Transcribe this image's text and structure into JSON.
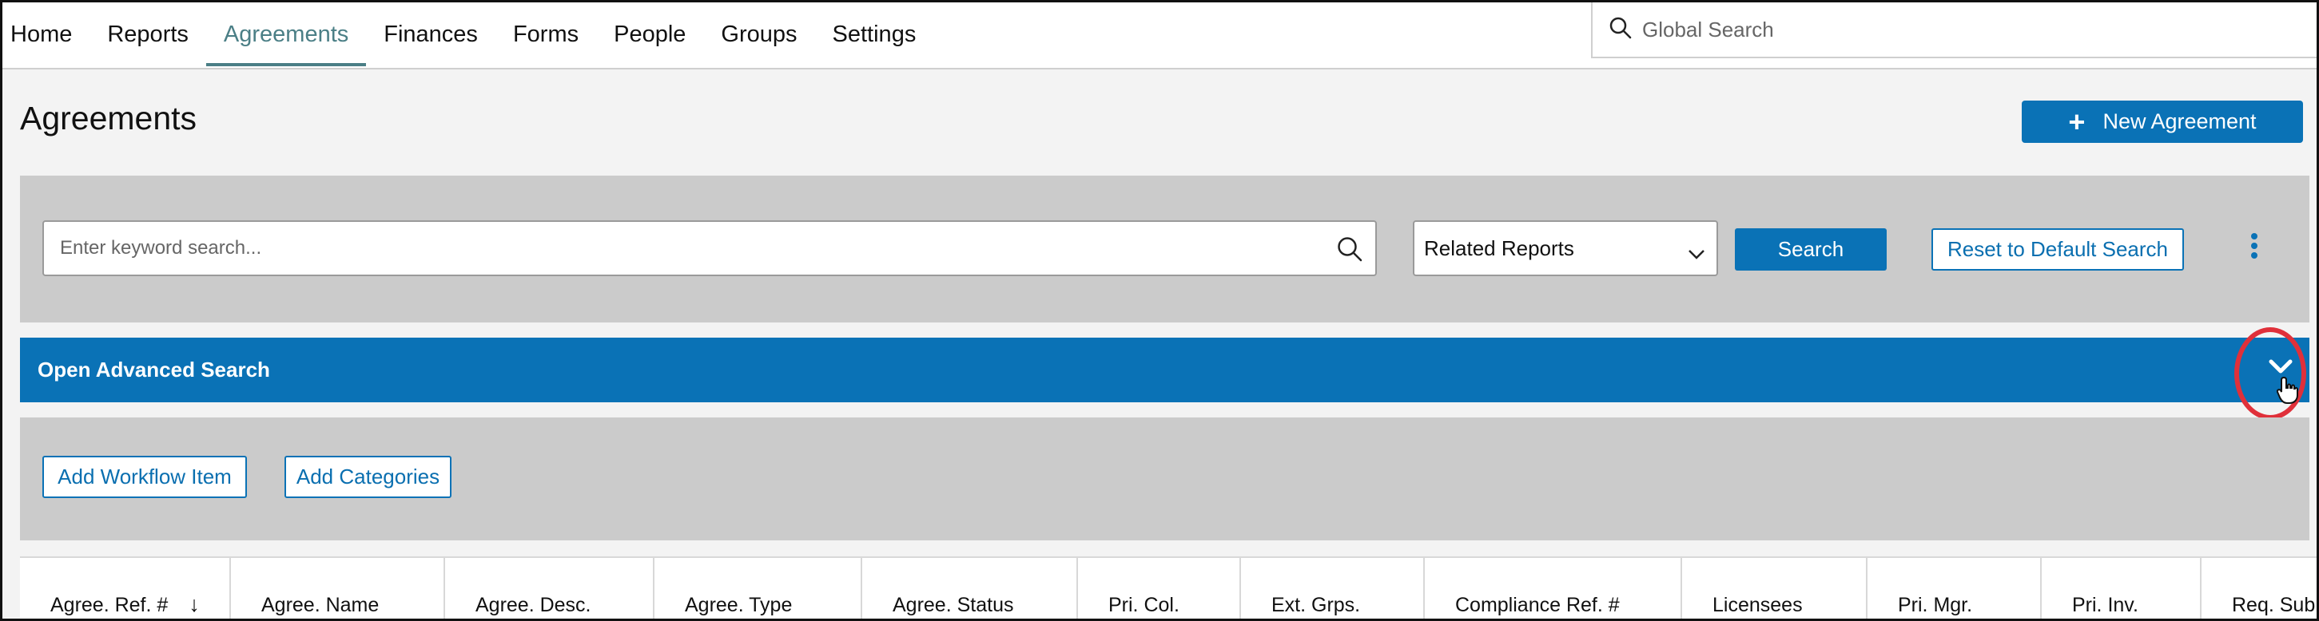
{
  "nav": {
    "items": [
      {
        "label": "Home",
        "active": false
      },
      {
        "label": "Reports",
        "active": false
      },
      {
        "label": "Agreements",
        "active": true
      },
      {
        "label": "Finances",
        "active": false
      },
      {
        "label": "Forms",
        "active": false
      },
      {
        "label": "People",
        "active": false
      },
      {
        "label": "Groups",
        "active": false
      },
      {
        "label": "Settings",
        "active": false
      }
    ],
    "global_search_placeholder": "Global Search"
  },
  "page": {
    "title": "Agreements",
    "new_button": "New Agreement"
  },
  "search": {
    "keyword_placeholder": "Enter keyword search...",
    "report_select_value": "Related Reports",
    "search_button": "Search",
    "reset_button": "Reset to Default Search"
  },
  "advanced": {
    "label": "Open Advanced Search"
  },
  "actions": {
    "workflow_button": "Add Workflow Item",
    "categories_button": "Add Categories"
  },
  "table": {
    "columns": [
      "Agree. Ref. #",
      "Agree. Name",
      "Agree. Desc.",
      "Agree. Type",
      "Agree. Status",
      "Pri. Col.",
      "Ext. Grps.",
      "Compliance Ref. #",
      "Licensees",
      "Pri. Mgr.",
      "Pri. Inv.",
      "Req. Subm"
    ],
    "sort_indicator": "↓"
  },
  "colors": {
    "primary": "#0a72b6",
    "active_nav": "#4b7f86",
    "panel_bg": "#cbcbcb",
    "highlight": "#e0303a"
  }
}
